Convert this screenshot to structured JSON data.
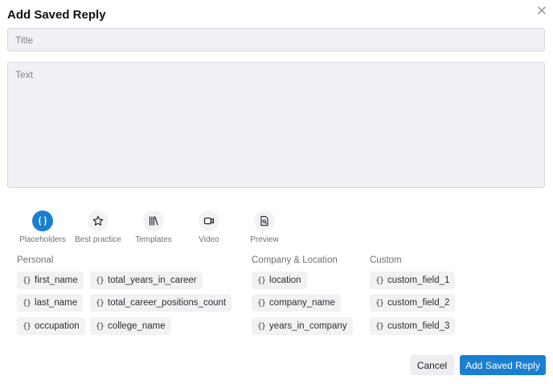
{
  "dialog": {
    "title": "Add Saved Reply",
    "close_symbol": "✕"
  },
  "form": {
    "title_placeholder": "Title",
    "text_placeholder": "Text"
  },
  "toolbar": {
    "items": [
      {
        "label": "Placeholders",
        "icon": "braces-icon",
        "active": true
      },
      {
        "label": "Best practice",
        "icon": "star-icon",
        "active": false
      },
      {
        "label": "Templates",
        "icon": "library-icon",
        "active": false
      },
      {
        "label": "Video",
        "icon": "video-icon",
        "active": false
      },
      {
        "label": "Preview",
        "icon": "preview-icon",
        "active": false
      }
    ]
  },
  "placeholders": {
    "brace_symbol": "{}",
    "groups": {
      "personal": {
        "label": "Personal",
        "items": [
          "first_name",
          "total_years_in_career",
          "last_name",
          "total_career_positions_count",
          "occupation",
          "college_name"
        ]
      },
      "company_location": {
        "label": "Company & Location",
        "items": [
          "location",
          "company_name",
          "years_in_company"
        ]
      },
      "custom": {
        "label": "Custom",
        "items": [
          "custom_field_1",
          "custom_field_2",
          "custom_field_3"
        ]
      }
    }
  },
  "actions": {
    "cancel_label": "Cancel",
    "submit_label": "Add Saved Reply"
  },
  "colors": {
    "accent": "#1a7fd1",
    "input_background": "#eff1f4",
    "chip_background": "#f1f2f4"
  }
}
